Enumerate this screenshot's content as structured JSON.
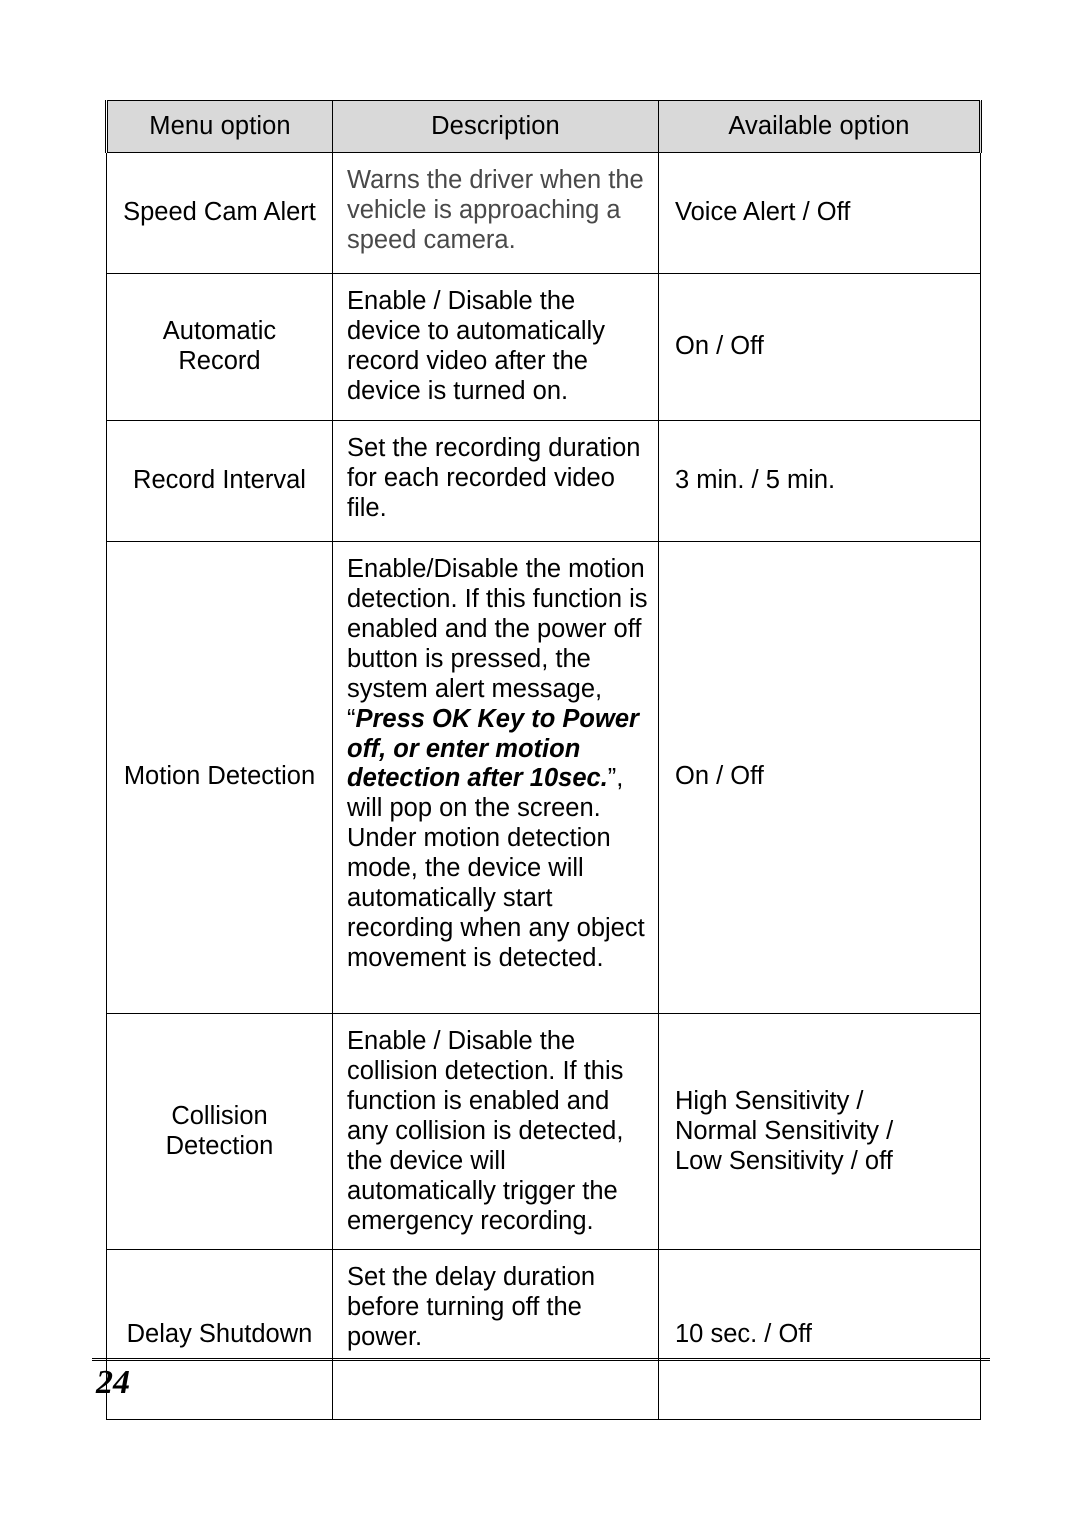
{
  "document": {
    "page_number": "24"
  },
  "table": {
    "headers": {
      "menu_option": "Menu option",
      "description": "Description",
      "available_option": "Available option"
    },
    "rows": [
      {
        "menu_option": "Speed Cam Alert",
        "description": "Warns the driver when the vehicle is approaching a speed camera.",
        "available_option": "Voice Alert / Off"
      },
      {
        "menu_option_line1": "Automatic",
        "menu_option_line2": "Record",
        "description": "Enable / Disable the device to automatically record video after the device is turned on.",
        "available_option": "On / Off"
      },
      {
        "menu_option": "Record Interval",
        "description": "Set the recording duration for each recorded video file.",
        "available_option": "3 min. / 5 min."
      },
      {
        "menu_option": "Motion Detection",
        "description_part1": "Enable/Disable the motion detection. If this function is enabled and the power off button is pressed, the system alert message, “",
        "description_emphasis": "Press OK Key to Power off, or enter motion detection after 10sec.",
        "description_part2": "”, will pop on the screen. Under motion detection mode, the device will automatically start recording when any object movement is detected.",
        "available_option": "On / Off"
      },
      {
        "menu_option_line1": "Collision",
        "menu_option_line2": "Detection",
        "description": "Enable / Disable the collision detection. If this function is enabled and any collision is detected, the device will automatically trigger the emergency recording.",
        "available_option_line1": "High Sensitivity /",
        "available_option_line2": "Normal Sensitivity /",
        "available_option_line3": "Low Sensitivity / off"
      },
      {
        "menu_option": "Delay Shutdown",
        "description": "Set the delay duration before turning off the power.",
        "available_option": "10 sec. / Off"
      }
    ]
  },
  "colors": {
    "header_fill": "#d9d9d9",
    "border": "#000000",
    "text": "#000000",
    "dim_text": "#494949"
  }
}
